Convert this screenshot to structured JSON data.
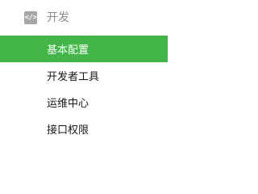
{
  "sidebar": {
    "section": {
      "icon": "code-icon",
      "icon_glyph": "</>",
      "label": "开发",
      "color": "#8c8c8c"
    },
    "active_color": "#44b549",
    "items": [
      {
        "label": "基本配置",
        "active": true
      },
      {
        "label": "开发者工具",
        "active": false
      },
      {
        "label": "运维中心",
        "active": false
      },
      {
        "label": "接口权限",
        "active": false
      }
    ]
  }
}
